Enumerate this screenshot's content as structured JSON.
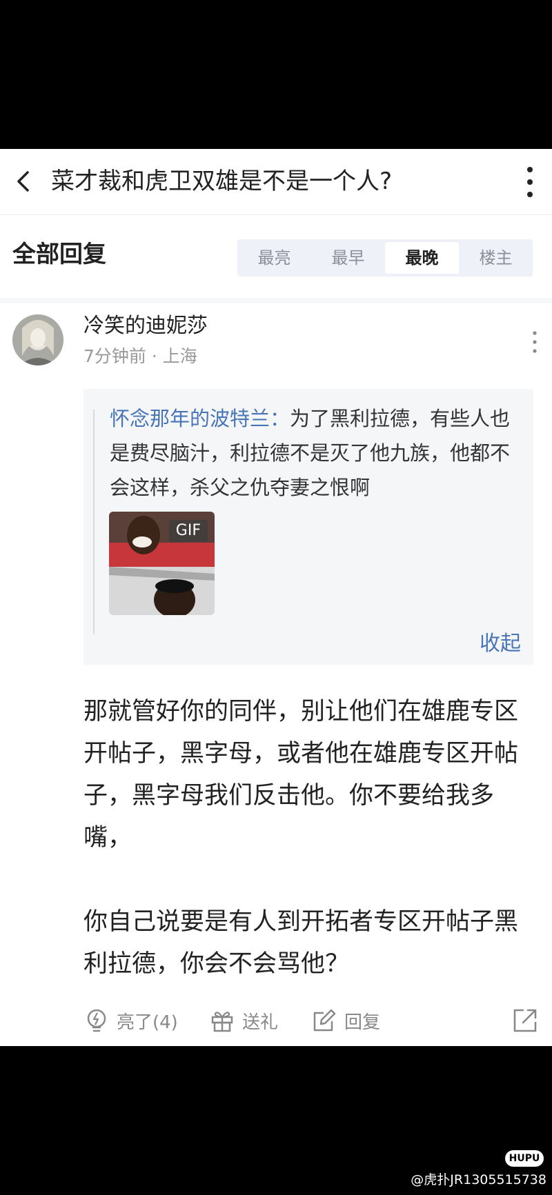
{
  "header": {
    "title": "菜才裁和虎卫双雄是不是一个人?"
  },
  "section": {
    "title": "全部回复"
  },
  "sort_tabs": [
    {
      "label": "最亮",
      "active": false
    },
    {
      "label": "最早",
      "active": false
    },
    {
      "label": "最晚",
      "active": true
    },
    {
      "label": "楼主",
      "active": false
    }
  ],
  "comment": {
    "username": "冷笑的迪妮莎",
    "meta": "7分钟前 · 上海",
    "quote": {
      "author": "怀念那年的波特兰",
      "separator": "：",
      "text": "为了黑利拉德，有些人也是费尽脑汁，利拉德不是灭了他九族，他都不会这样，杀父之仇夺妻之恨啊",
      "gif_badge": "GIF",
      "collapse_label": "收起"
    },
    "body_para1": "那就管好你的同伴，别让他们在雄鹿专区开帖子，黑字母，或者他在雄鹿专区开帖子，黑字母我们反击他。你不要给我多嘴，",
    "body_para2": "你自己说要是有人到开拓者专区开帖子黑利拉德，你会不会骂他？",
    "actions": {
      "like_label": "亮了(4)",
      "gift_label": "送礼",
      "reply_label": "回复"
    }
  },
  "watermark": {
    "logo_text": "HUPU",
    "text": "@虎扑JR1305515738"
  },
  "colors": {
    "link": "#4775b8",
    "tab_bg": "#eef1f8",
    "quote_bg": "#f5f6f8"
  }
}
